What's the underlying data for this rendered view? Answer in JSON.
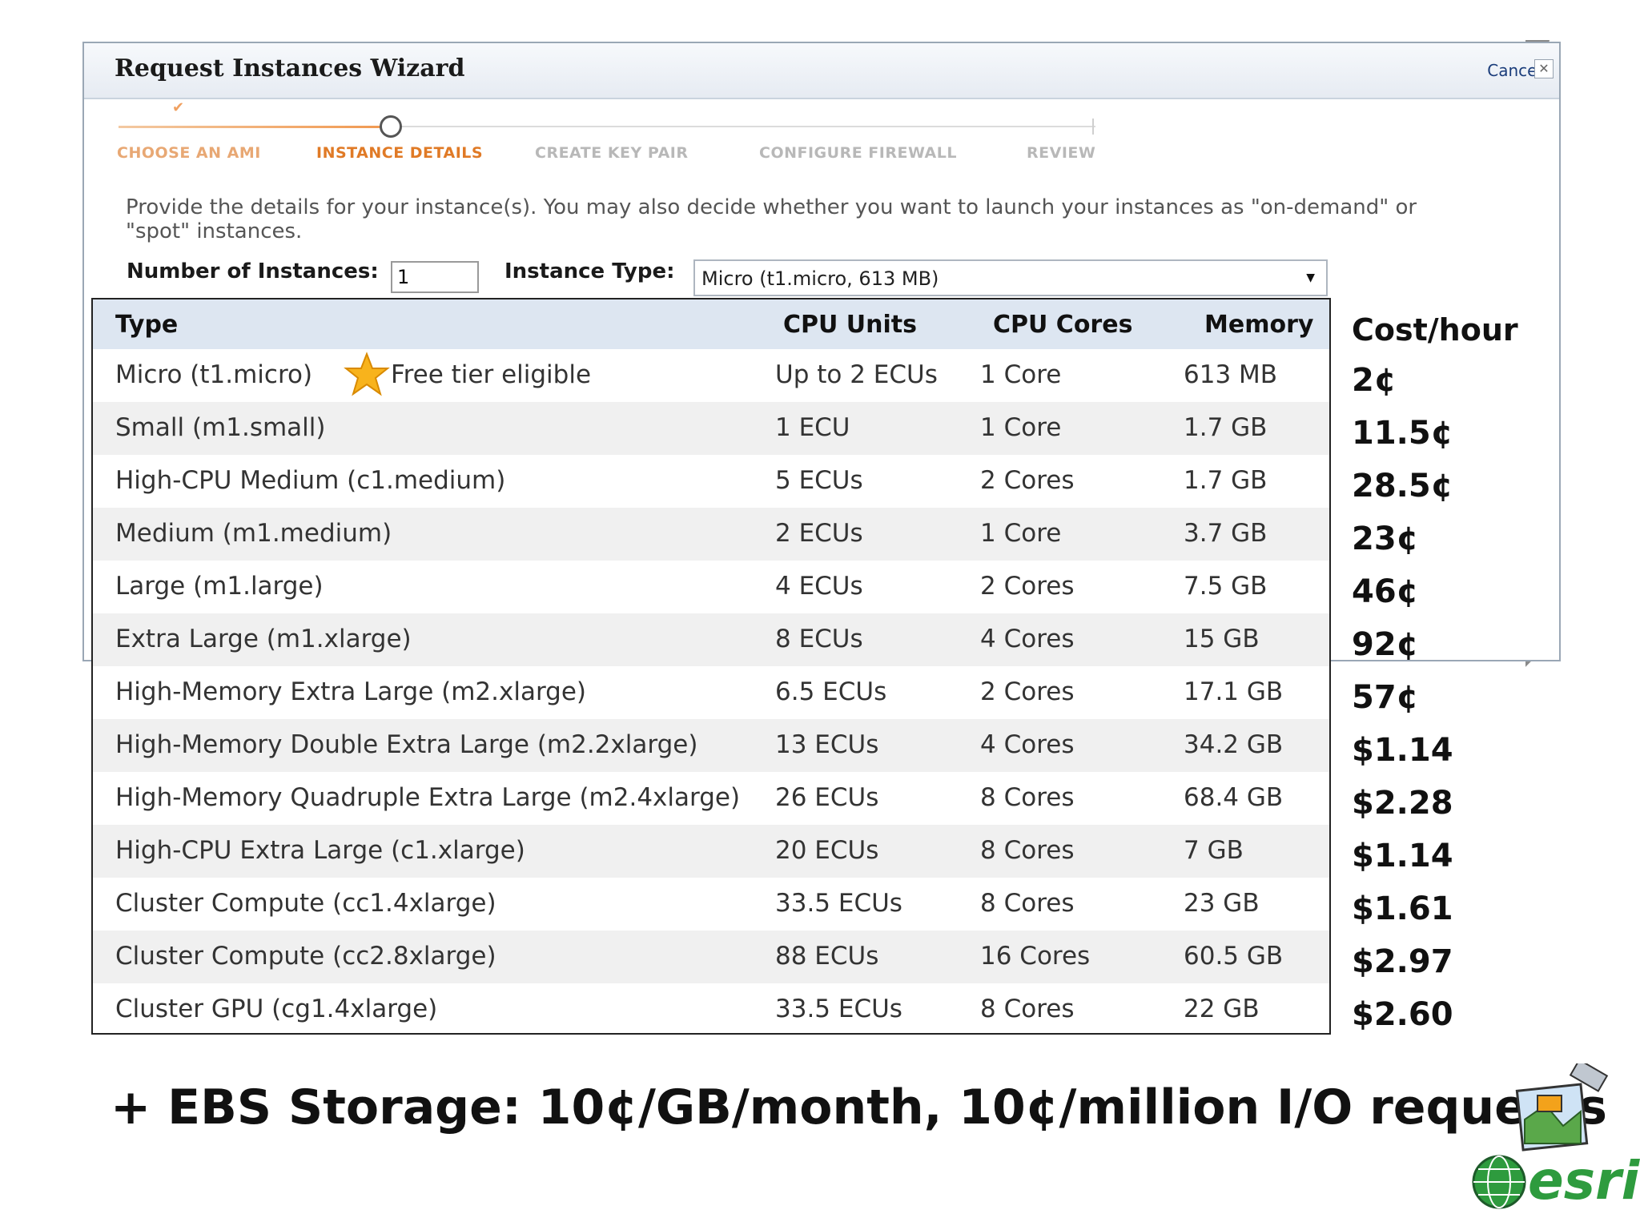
{
  "wizard": {
    "title": "Request Instances Wizard",
    "cancel": "Cancel",
    "close": "✕",
    "steps": [
      {
        "label": "CHOOSE AN AMI",
        "state": "done"
      },
      {
        "label": "INSTANCE DETAILS",
        "state": "active"
      },
      {
        "label": "CREATE KEY PAIR",
        "state": "todo"
      },
      {
        "label": "CONFIGURE FIREWALL",
        "state": "todo"
      },
      {
        "label": "REVIEW",
        "state": "todo"
      }
    ],
    "description": "Provide the details for your instance(s). You may also decide whether you want to launch your instances as \"on-demand\" or \"spot\" instances.",
    "number_label": "Number of Instances:",
    "number_value": "1",
    "type_label": "Instance Type:",
    "type_value": "Micro (t1.micro, 613 MB)"
  },
  "table": {
    "headers": [
      "Type",
      "CPU Units",
      "CPU Cores",
      "Memory"
    ],
    "free_tier": "Free tier eligible",
    "rows": [
      {
        "type": "Micro (t1.micro)",
        "units": "Up to 2 ECUs",
        "cores": "1 Core",
        "memory": "613 MB"
      },
      {
        "type": "Small (m1.small)",
        "units": "1 ECU",
        "cores": "1 Core",
        "memory": "1.7 GB"
      },
      {
        "type": "High-CPU Medium (c1.medium)",
        "units": "5 ECUs",
        "cores": "2 Cores",
        "memory": "1.7 GB"
      },
      {
        "type": "Medium (m1.medium)",
        "units": "2 ECUs",
        "cores": "1 Core",
        "memory": "3.7 GB"
      },
      {
        "type": "Large (m1.large)",
        "units": "4 ECUs",
        "cores": "2 Cores",
        "memory": "7.5 GB"
      },
      {
        "type": "Extra Large (m1.xlarge)",
        "units": "8 ECUs",
        "cores": "4 Cores",
        "memory": "15 GB"
      },
      {
        "type": "High-Memory Extra Large (m2.xlarge)",
        "units": "6.5 ECUs",
        "cores": "2 Cores",
        "memory": "17.1 GB"
      },
      {
        "type": "High-Memory Double Extra Large (m2.2xlarge)",
        "units": "13 ECUs",
        "cores": "4 Cores",
        "memory": "34.2 GB"
      },
      {
        "type": "High-Memory Quadruple Extra Large (m2.4xlarge)",
        "units": "26 ECUs",
        "cores": "8 Cores",
        "memory": "68.4 GB"
      },
      {
        "type": "High-CPU Extra Large (c1.xlarge)",
        "units": "20 ECUs",
        "cores": "8 Cores",
        "memory": "7 GB"
      },
      {
        "type": "Cluster Compute (cc1.4xlarge)",
        "units": "33.5 ECUs",
        "cores": "8 Cores",
        "memory": "23 GB"
      },
      {
        "type": "Cluster Compute (cc2.8xlarge)",
        "units": "88 ECUs",
        "cores": "16 Cores",
        "memory": "60.5 GB"
      },
      {
        "type": "Cluster GPU (cg1.4xlarge)",
        "units": "33.5 ECUs",
        "cores": "8 Cores",
        "memory": "22 GB"
      }
    ]
  },
  "cost": {
    "header": "Cost/hour",
    "values": [
      "2¢",
      "11.5¢",
      "28.5¢",
      "23¢",
      "46¢",
      "92¢",
      "57¢",
      "$1.14",
      "$2.28",
      "$1.14",
      "$1.61",
      "$2.97",
      "$2.60"
    ]
  },
  "footer_note": "+ EBS Storage: 10¢/GB/month, 10¢/million I/O requests",
  "logo": {
    "text": "esri",
    "color": "#2e9b3e"
  },
  "icons": {
    "star": "star-icon",
    "dropdown": "chevron-down-icon",
    "globe": "globe-icon"
  }
}
